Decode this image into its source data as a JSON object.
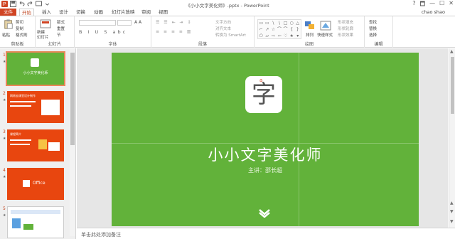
{
  "window": {
    "title": "《小小文字美化师》.pptx - PowerPoint",
    "controls": [
      "?",
      "🗖",
      "—",
      "☐",
      "✕"
    ]
  },
  "tabs": [
    {
      "label": "文件"
    },
    {
      "label": "开始"
    },
    {
      "label": "插入"
    },
    {
      "label": "设计"
    },
    {
      "label": "切换"
    },
    {
      "label": "动画"
    },
    {
      "label": "幻灯片放映"
    },
    {
      "label": "审阅"
    },
    {
      "label": "视图"
    }
  ],
  "user": "chao shao",
  "ribbon": {
    "clipboard": {
      "group": "剪贴板",
      "paste": "粘贴",
      "cut": "剪切",
      "copy": "复制",
      "format": "格式刷"
    },
    "slides": {
      "group": "幻灯片",
      "new_slide": "新建\n幻灯片",
      "layout": "版式",
      "reset": "重置",
      "section": "节"
    },
    "font": {
      "group": "字体"
    },
    "paragraph": {
      "group": "段落",
      "text_direction": "文字方向",
      "align_text": "对齐文本",
      "smartart": "转换为 SmartArt"
    },
    "drawing": {
      "group": "绘图",
      "arrange": "排列",
      "quick_styles": "快速样式",
      "fill": "形状填充",
      "outline": "形状轮廓",
      "effects": "形状效果"
    },
    "editing": {
      "group": "编辑",
      "find": "查找",
      "replace": "替换",
      "select": "选择"
    }
  },
  "thumbnails": [
    {
      "num": "1",
      "title": "小小文字美化师",
      "sel": true
    },
    {
      "num": "2",
      "title": "网易云课堂设计制作"
    },
    {
      "num": "3",
      "title": "课程简介"
    },
    {
      "num": "4",
      "title": "Office"
    },
    {
      "num": "5",
      "title": ""
    }
  ],
  "slide": {
    "icon_char": "字",
    "icon_tag": "a",
    "title": "小小文字美化师",
    "speaker": "主讲：邵长超",
    "accent": "#62b23a"
  },
  "notes": {
    "placeholder": "单击此处添加备注"
  },
  "colors": {
    "file_tab": "#d04423",
    "slide_bg": "#62b23a",
    "thumb_orange": "#e8460f"
  }
}
